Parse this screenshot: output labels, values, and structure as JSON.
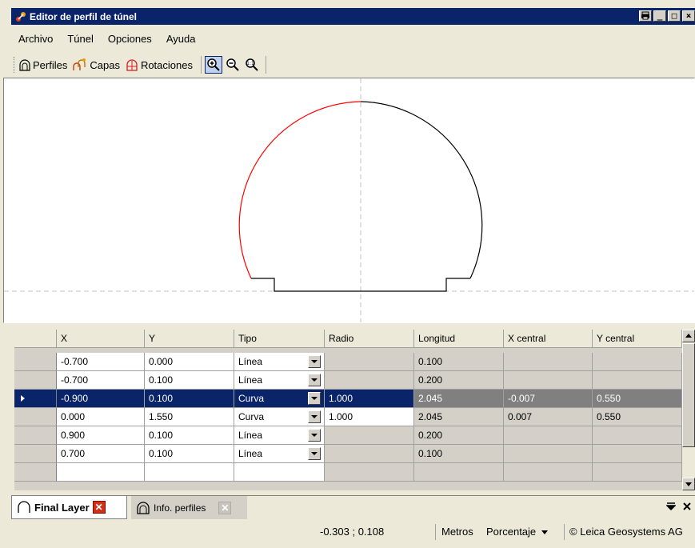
{
  "window": {
    "title": "Editor de perfil de túnel",
    "buttons": [
      "print",
      "minimize",
      "maximize",
      "close"
    ]
  },
  "menu": [
    "Archivo",
    "Túnel",
    "Opciones",
    "Ayuda"
  ],
  "toolbar": {
    "perfiles": "Perfiles",
    "capas": "Capas",
    "rotaciones": "Rotaciones",
    "zoom_buttons": [
      "zoom-in-icon",
      "zoom-out-icon",
      "zoom-fit-icon"
    ]
  },
  "canvas": {
    "profile_colors": {
      "left_arc": "#ff0000",
      "right_arc": "#000000",
      "axis": "#c0c0c0"
    }
  },
  "grid": {
    "columns": [
      "X",
      "Y",
      "Tipo",
      "Radio",
      "Longitud",
      "X central",
      "Y central"
    ],
    "rows": [
      {
        "x": "-0.700",
        "y": "0.000",
        "tipo": "Línea",
        "radio": "",
        "longitud": "0.100",
        "xc": "",
        "yc": ""
      },
      {
        "x": "-0.700",
        "y": "0.100",
        "tipo": "Línea",
        "radio": "",
        "longitud": "0.200",
        "xc": "",
        "yc": ""
      },
      {
        "x": "-0.900",
        "y": "0.100",
        "tipo": "Curva",
        "radio": "1.000",
        "longitud": "2.045",
        "xc": "-0.007",
        "yc": "0.550"
      },
      {
        "x": "0.000",
        "y": "1.550",
        "tipo": "Curva",
        "radio": "1.000",
        "longitud": "2.045",
        "xc": "0.007",
        "yc": "0.550"
      },
      {
        "x": "0.900",
        "y": "0.100",
        "tipo": "Línea",
        "radio": "",
        "longitud": "0.200",
        "xc": "",
        "yc": ""
      },
      {
        "x": "0.700",
        "y": "0.100",
        "tipo": "Línea",
        "radio": "",
        "longitud": "0.100",
        "xc": "",
        "yc": ""
      }
    ],
    "selected_row": 2
  },
  "tabs": [
    {
      "label": "Final Layer",
      "active": true
    },
    {
      "label": "Info. perfiles",
      "active": false
    }
  ],
  "status": {
    "coords": "-0.303 ; 0.108",
    "units": "Metros",
    "mode": "Porcentaje",
    "copyright": "© Leica Geosystems AG"
  },
  "colors": {
    "title_bar": "#0a246a",
    "selection": "#0a246a",
    "face": "#ece9d8"
  }
}
